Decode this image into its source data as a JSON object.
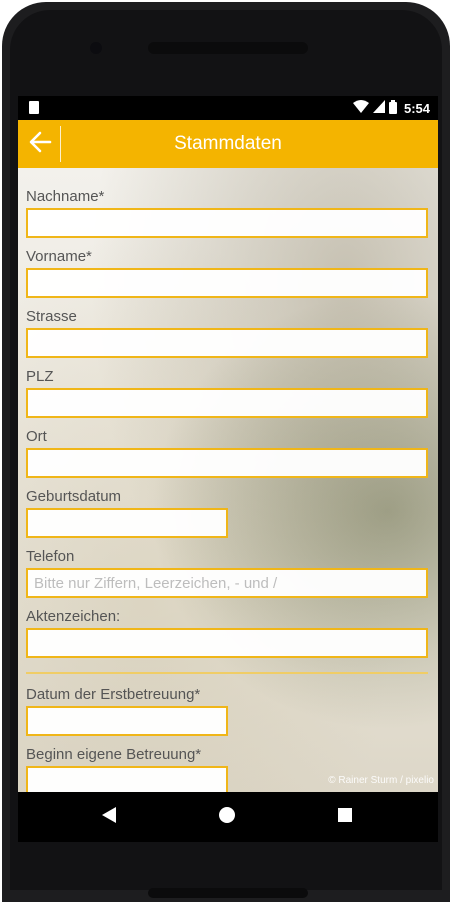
{
  "status_bar": {
    "time": "5:54",
    "icons": [
      "sim-card-icon",
      "wifi-icon",
      "signal-icon",
      "battery-icon"
    ]
  },
  "app_bar": {
    "title": "Stammdaten",
    "back_icon": "arrow-left-icon",
    "background_color": "#f4b400"
  },
  "form": {
    "fields": [
      {
        "label": "Nachname*",
        "value": "",
        "placeholder": ""
      },
      {
        "label": "Vorname*",
        "value": "",
        "placeholder": ""
      },
      {
        "label": "Strasse",
        "value": "",
        "placeholder": ""
      },
      {
        "label": "PLZ",
        "value": "",
        "placeholder": ""
      },
      {
        "label": "Ort",
        "value": "",
        "placeholder": ""
      },
      {
        "label": "Geburtsdatum",
        "value": "",
        "placeholder": ""
      },
      {
        "label": "Telefon",
        "value": "",
        "placeholder": "Bitte nur Ziffern, Leerzeichen, - und /"
      },
      {
        "label": "Aktenzeichen:",
        "value": "",
        "placeholder": ""
      },
      {
        "label": "Datum der Erstbetreuung*",
        "value": "",
        "placeholder": ""
      },
      {
        "label": "Beginn eigene Betreuung*",
        "value": "",
        "placeholder": ""
      }
    ],
    "border_color": "#f0b618"
  },
  "background_credit": "© Rainer Sturm / pixelio",
  "nav_bar": {
    "buttons": [
      "back-triangle-icon",
      "home-circle-icon",
      "recents-square-icon"
    ]
  }
}
